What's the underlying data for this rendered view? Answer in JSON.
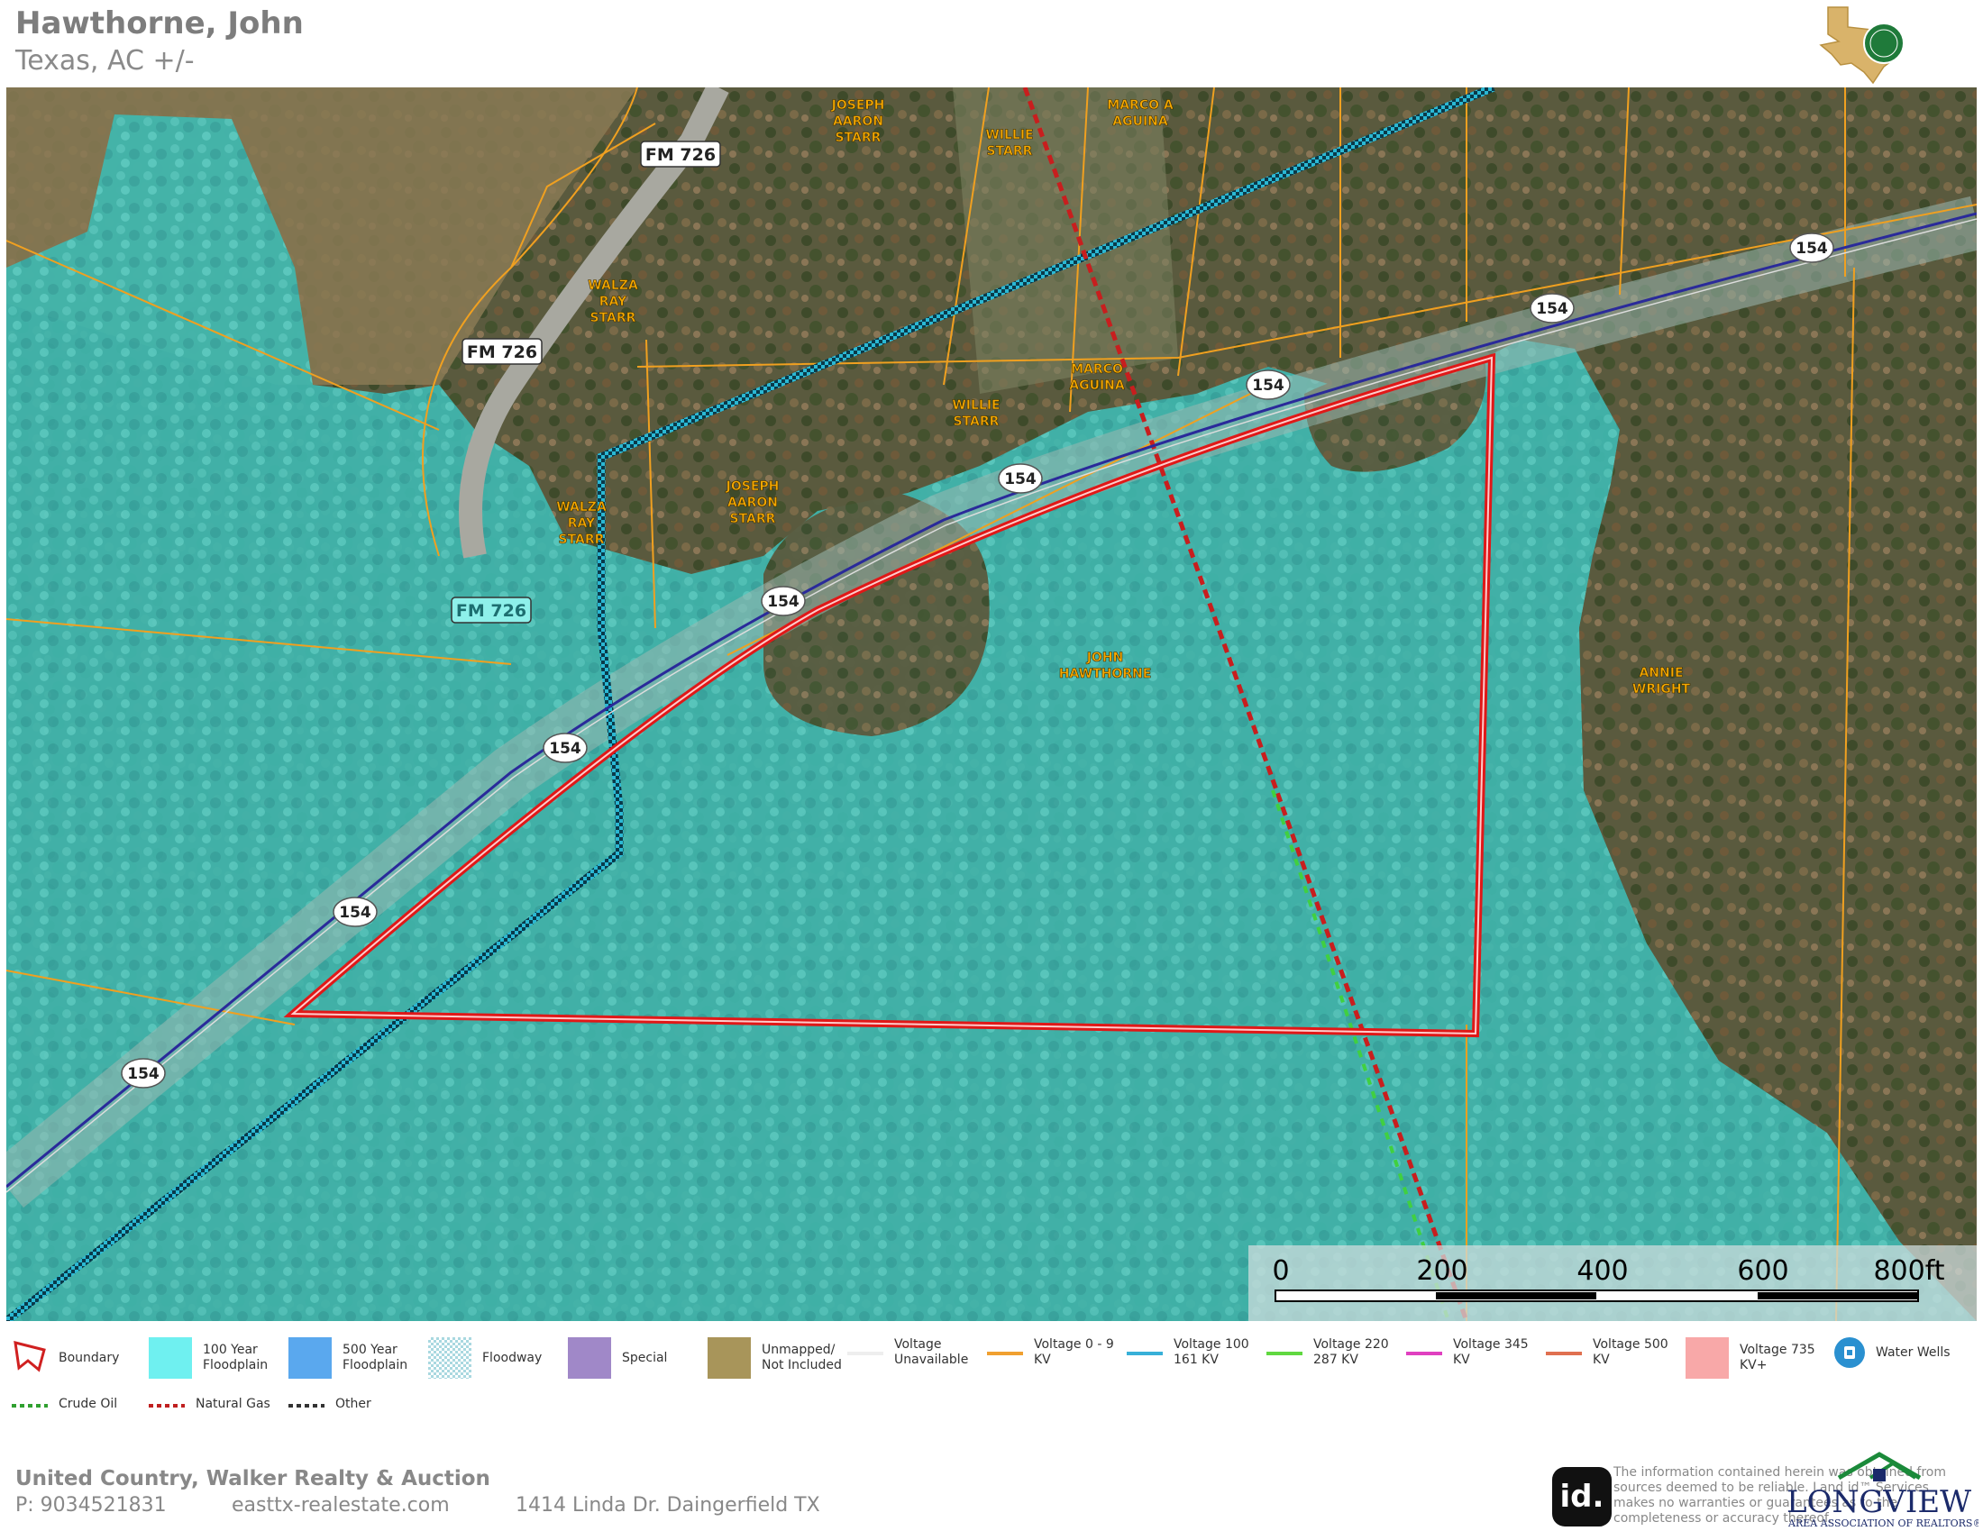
{
  "header": {
    "title": "Hawthorne, John",
    "subtitle": "Texas,  AC +/-"
  },
  "map": {
    "parcel_owners": [
      {
        "label": "JOSEPH\nAARON\nSTARR",
        "id": "joseph-aaron-starr-north"
      },
      {
        "label": "WILLIE\nSTARR",
        "id": "willie-starr-north"
      },
      {
        "label": "MARCO A\nAGUINA",
        "id": "marco-a-aguina"
      },
      {
        "label": "WALZA\nRAY\nSTARR",
        "id": "walza-ray-starr-north"
      },
      {
        "label": "MARCO\nAGUINA",
        "id": "marco-aguina"
      },
      {
        "label": "WILLIE\nSTARR",
        "id": "willie-starr-south"
      },
      {
        "label": "JOSEPH\nAARON\nSTARR",
        "id": "joseph-aaron-starr-south"
      },
      {
        "label": "WALZA\nRAY\nSTARR",
        "id": "walza-ray-starr-south"
      },
      {
        "label": "JOHN\nHAWTHORNE",
        "id": "john-hawthorne"
      },
      {
        "label": "ANNIE\nWRIGHT",
        "id": "annie-wright"
      }
    ],
    "road_labels": [
      "FM 726",
      "FM 726",
      "FM 726"
    ],
    "highway_shields": [
      "154",
      "154",
      "154",
      "154",
      "154",
      "154",
      "154",
      "154"
    ],
    "scale": {
      "ticks": [
        "0",
        "200",
        "400",
        "600",
        "800ft"
      ]
    },
    "colors": {
      "floodplain_100": "#4fd8d2",
      "boundary": "#e01818",
      "parcel_line": "#f0a020",
      "natural_gas": "#c81e1e",
      "floodway": "#2fb8d8",
      "highway": "#2a2a9a"
    }
  },
  "legend": {
    "row1": [
      {
        "label": "Boundary",
        "icon": "boundary-icon"
      },
      {
        "label": "100 Year\nFloodplain",
        "icon": "swatch",
        "color": "#6ff0f0"
      },
      {
        "label": "500 Year\nFloodplain",
        "icon": "swatch",
        "color": "#5aa8ee"
      },
      {
        "label": "Floodway",
        "icon": "hatched-swatch",
        "color": "#a9d8e0"
      },
      {
        "label": "Special",
        "icon": "swatch",
        "color": "#a088c8"
      },
      {
        "label": "Unmapped/\nNot Included",
        "icon": "swatch",
        "color": "#a8955a"
      },
      {
        "label": "Voltage\nUnavailable",
        "icon": "line",
        "color": "#eeeeee"
      },
      {
        "label": "Voltage 0 - 9\nKV",
        "icon": "line",
        "color": "#f0a030"
      },
      {
        "label": "Voltage 100\n161 KV",
        "icon": "line",
        "color": "#38b0d8"
      },
      {
        "label": "Voltage 220\n287 KV",
        "icon": "line",
        "color": "#60d840"
      },
      {
        "label": "Voltage 345\nKV",
        "icon": "line",
        "color": "#e040c0"
      },
      {
        "label": "Voltage 500\nKV",
        "icon": "line",
        "color": "#e07050"
      },
      {
        "label": "Voltage  735\nKV+",
        "icon": "swatch",
        "color": "#f8a8a8"
      },
      {
        "label": "Water Wells",
        "icon": "water-well-icon",
        "color": "#2a90d0"
      }
    ],
    "row2": [
      {
        "label": "Crude Oil",
        "icon": "dashed-line",
        "color": "#30a030"
      },
      {
        "label": "Natural Gas",
        "icon": "dashed-line",
        "color": "#c02020"
      },
      {
        "label": "Other",
        "icon": "dashed-line",
        "color": "#333333"
      }
    ]
  },
  "footer": {
    "company": "United Country, Walker Realty & Auction",
    "phone": "P: 9034521831",
    "website": "easttx-realestate.com",
    "address": "1414 Linda Dr. Daingerfield TX",
    "disclaimer": "The information contained herein was obtained from sources deemed to be reliable. Land id™ Services makes no warranties or guarantees as to the completeness or accuracy thereof.",
    "id_logo": "id.",
    "longview_name": "LONGVIEW",
    "longview_sub": "AREA ASSOCIATION OF REALTORS®"
  }
}
